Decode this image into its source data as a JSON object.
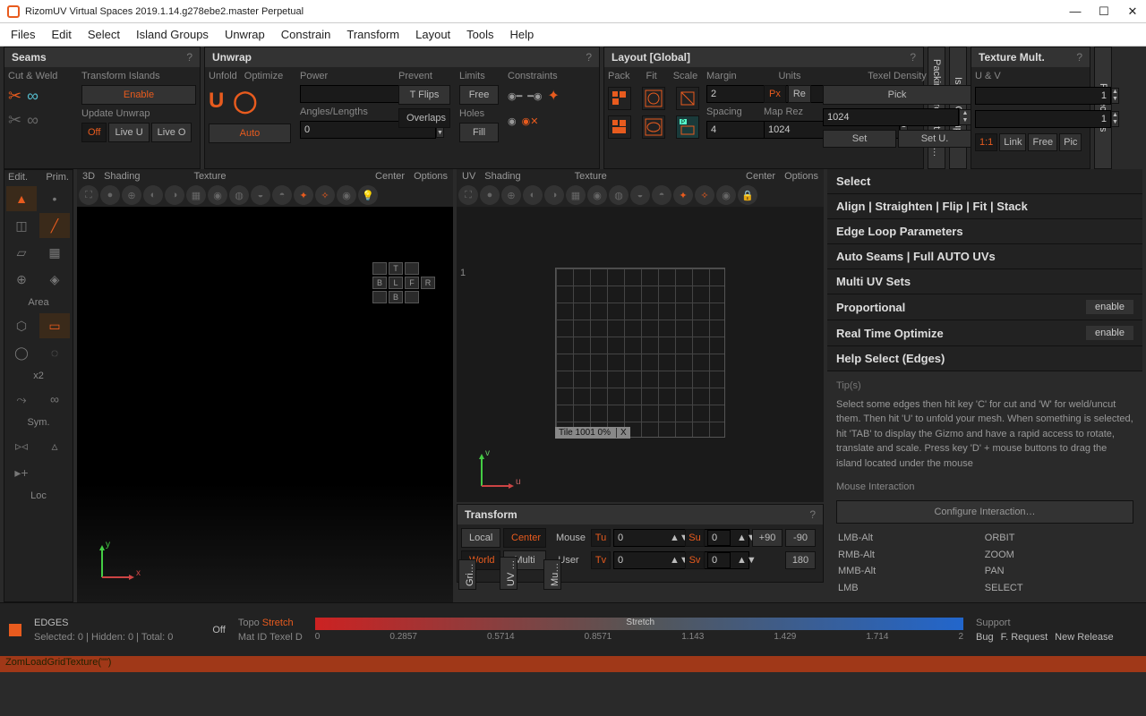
{
  "window": {
    "title": "RizomUV  Virtual Spaces 2019.1.14.g278ebe2.master Perpetual",
    "controls": {
      "min": "—",
      "max": "☐",
      "close": "✕"
    }
  },
  "menu": [
    "Files",
    "Edit",
    "Select",
    "Island Groups",
    "Unwrap",
    "Constrain",
    "Transform",
    "Layout",
    "Tools",
    "Help"
  ],
  "seams": {
    "title": "Seams",
    "cut_weld": "Cut & Weld",
    "transform_islands": "Transform Islands",
    "enable": "Enable",
    "update_unwrap": "Update Unwrap",
    "off": "Off",
    "live_u": "Live U",
    "live_o": "Live O"
  },
  "unwrap": {
    "title": "Unwrap",
    "unfold": "Unfold",
    "optimize": "Optimize",
    "auto": "Auto",
    "power": "Power",
    "angles": "Angles/Lengths",
    "angles_val": "0",
    "prevent": "Prevent",
    "tflips": "T Flips",
    "overlaps": "Overlaps",
    "limits": "Limits",
    "free": "Free",
    "holes": "Holes",
    "fill": "Fill",
    "constraints": "Constraints"
  },
  "layout": {
    "title": "Layout [Global]",
    "pack": "Pack",
    "fit": "Fit",
    "scale": "Scale",
    "margin": "Margin",
    "margin1": "2",
    "spacing": "Spacing",
    "spacing_val": "4",
    "units": "Units",
    "px": "Px",
    "re": "Re",
    "maprez": "Map Rez",
    "maprez_val": "1024",
    "maprez2": "1024",
    "texel": "Texel Density",
    "pick": "Pick",
    "set": "Set",
    "setu": "Set U."
  },
  "texmult": {
    "title": "Texture Mult.",
    "uv": "U & V",
    "v1": "1",
    "v2": "1",
    "ratio": "1:1",
    "link": "Link",
    "free": "Free",
    "pic": "Pic"
  },
  "vtabs": {
    "pack": "Packing Properties […",
    "island": "Island Groups",
    "proj": "Projections"
  },
  "left_tools": {
    "edit": "Edit.",
    "prim": "Prim.",
    "keys": [
      "x2",
      "∞",
      "Sym.",
      "Loc"
    ],
    "area": "Area"
  },
  "view3d": {
    "labels": {
      "l3d": "3D",
      "shading": "Shading",
      "texture": "Texture",
      "center": "Center",
      "options": "Options"
    },
    "cube": {
      "t": "T",
      "b": "B",
      "l": "L",
      "f": "F",
      "r": "R",
      "b2": "B"
    },
    "axis": {
      "x": "x",
      "y": "y"
    }
  },
  "viewuv": {
    "labels": {
      "uv": "UV",
      "shading": "Shading",
      "texture": "Texture",
      "center": "Center",
      "options": "Options"
    },
    "tile": "Tile 1001 0%",
    "x": "X",
    "one": "1",
    "axis": {
      "u": "u",
      "v": "v"
    },
    "btabs": {
      "grid": "Gri…",
      "uvt": "UV …",
      "mu": "Mu…"
    }
  },
  "transform_panel": {
    "title": "Transform",
    "local": "Local",
    "center": "Center",
    "mouse": "Mouse",
    "world": "World",
    "multi": "Multi",
    "user": "User",
    "tu": "Tu",
    "tv": "Tv",
    "su": "Su",
    "sv": "Sv",
    "zero": "0",
    "p90": "+90",
    "m90": "-90",
    "r180": "180"
  },
  "right": {
    "select": "Select",
    "align": "Align | Straighten | Flip | Fit | Stack",
    "edge_loop": "Edge Loop Parameters",
    "auto_seams": "Auto Seams | Full AUTO UVs",
    "multi_uv": "Multi UV Sets",
    "proportional": "Proportional",
    "rto": "Real Time Optimize",
    "enable": "enable",
    "help_title": "Help Select (Edges)",
    "tips": "Tip(s)",
    "help_text": "Select some edges then hit key 'C' for cut and 'W' for weld/uncut them. Then hit 'U' to unfold your mesh. When something is selected, hit 'TAB' to display the Gizmo and have a rapid access to rotate, translate and scale. Press key 'D' + mouse buttons to drag the island located under the mouse",
    "mouse_int": "Mouse Interaction",
    "config": "Configure Interaction…",
    "rows": [
      [
        "LMB-Alt",
        "ORBIT"
      ],
      [
        "RMB-Alt",
        "ZOOM"
      ],
      [
        "MMB-Alt",
        "PAN"
      ],
      [
        "LMB",
        "SELECT"
      ]
    ]
  },
  "status": {
    "mode": "EDGES",
    "sel": "Selected: 0 | Hidden: 0 | Total: 0",
    "off": "Off",
    "topo": "Topo",
    "stretch": "Stretch",
    "matid": "Mat ID",
    "texeld": "Texel D",
    "ticks": [
      "0",
      "0.2857",
      "0.5714",
      "0.8571",
      "1.143",
      "1.429",
      "1.714",
      "2"
    ],
    "gradlbl": "Stretch",
    "support": "Support",
    "bug": "Bug",
    "freq": "F. Request",
    "newrel": "New Release"
  },
  "cmd": "ZomLoadGridTexture(\"\")"
}
